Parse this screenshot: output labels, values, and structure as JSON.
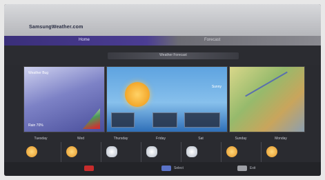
{
  "header": {
    "app_title": "SamsungWeather.com"
  },
  "tabs": [
    {
      "label": "Home"
    },
    {
      "label": "Forecast"
    }
  ],
  "section": {
    "title": "Weather Forecast"
  },
  "tiles": [
    {
      "label": "Weather Bug",
      "caption": "Rain 70%"
    },
    {
      "note": "Sunny",
      "box_1": "",
      "box_2": "",
      "box_3": ""
    },
    {
      "label": ""
    }
  ],
  "forecast": {
    "days": [
      {
        "name": "Tuesday",
        "icon": "sun-icon",
        "high": "",
        "low": ""
      },
      {
        "name": "Wed",
        "icon": "sun-icon",
        "high": "",
        "low": ""
      },
      {
        "name": "Thursday",
        "icon": "cloud-icon",
        "high": "",
        "low": ""
      },
      {
        "name": "Friday",
        "icon": "cloud-icon",
        "high": "",
        "low": ""
      },
      {
        "name": "Sat",
        "icon": "cloud-icon",
        "high": "",
        "low": ""
      },
      {
        "name": "Sunday",
        "icon": "sun-icon",
        "high": "",
        "low": ""
      },
      {
        "name": "Monday",
        "icon": "sun-icon",
        "high": "",
        "low": ""
      }
    ]
  },
  "footer": {
    "keys": [
      {
        "color": "#c82c2c",
        "label": ""
      },
      {
        "color": "#5a73c8",
        "label": "Select"
      },
      {
        "color": "#9ea0a6",
        "label": "Exit"
      }
    ]
  }
}
